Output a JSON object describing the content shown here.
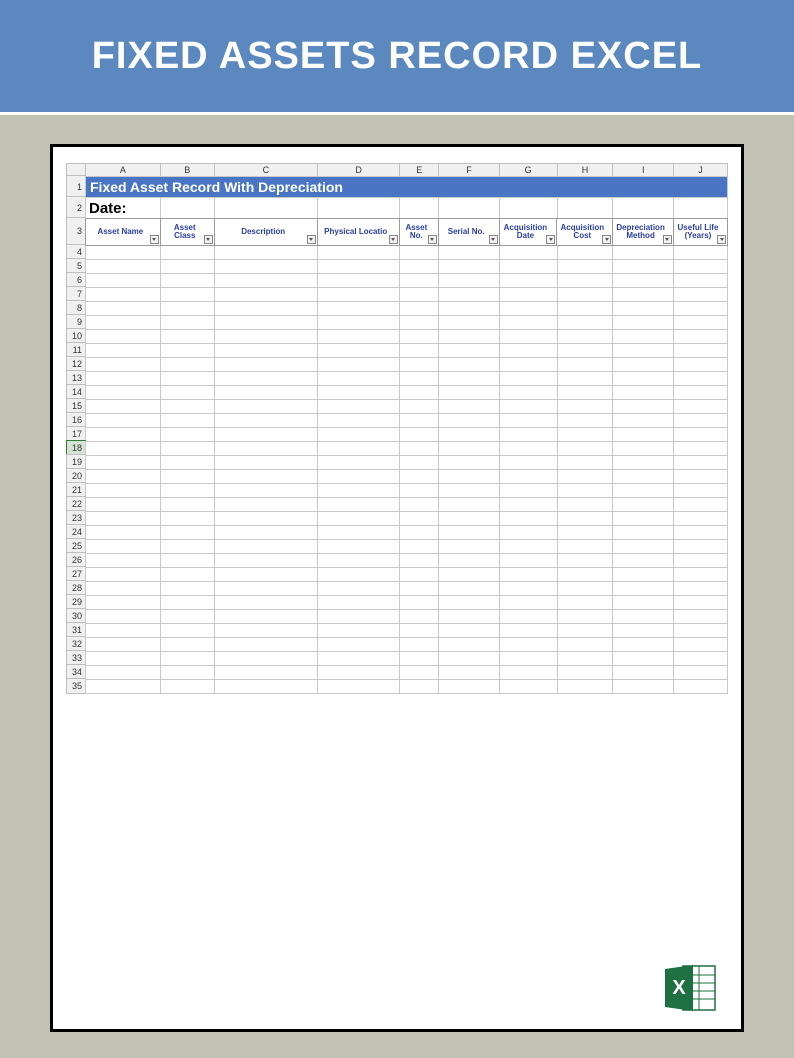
{
  "banner": {
    "title": "FIXED ASSETS RECORD EXCEL"
  },
  "sheet": {
    "title": "Fixed Asset Record With Depreciation",
    "date_label": "Date:",
    "columns": [
      "A",
      "B",
      "C",
      "D",
      "E",
      "F",
      "G",
      "H",
      "I",
      "J"
    ],
    "headers": [
      "Asset Name",
      "Asset Class",
      "Description",
      "Physical Locatio",
      "Asset No.",
      "Serial No.",
      "Acquisition Date",
      "Acquisition Cost",
      "Depreciation Method",
      "Useful Life (Years)"
    ],
    "first_data_row": 4,
    "last_data_row": 35,
    "selected_row": 18
  },
  "icon": {
    "name": "excel-icon",
    "letter": "X"
  }
}
